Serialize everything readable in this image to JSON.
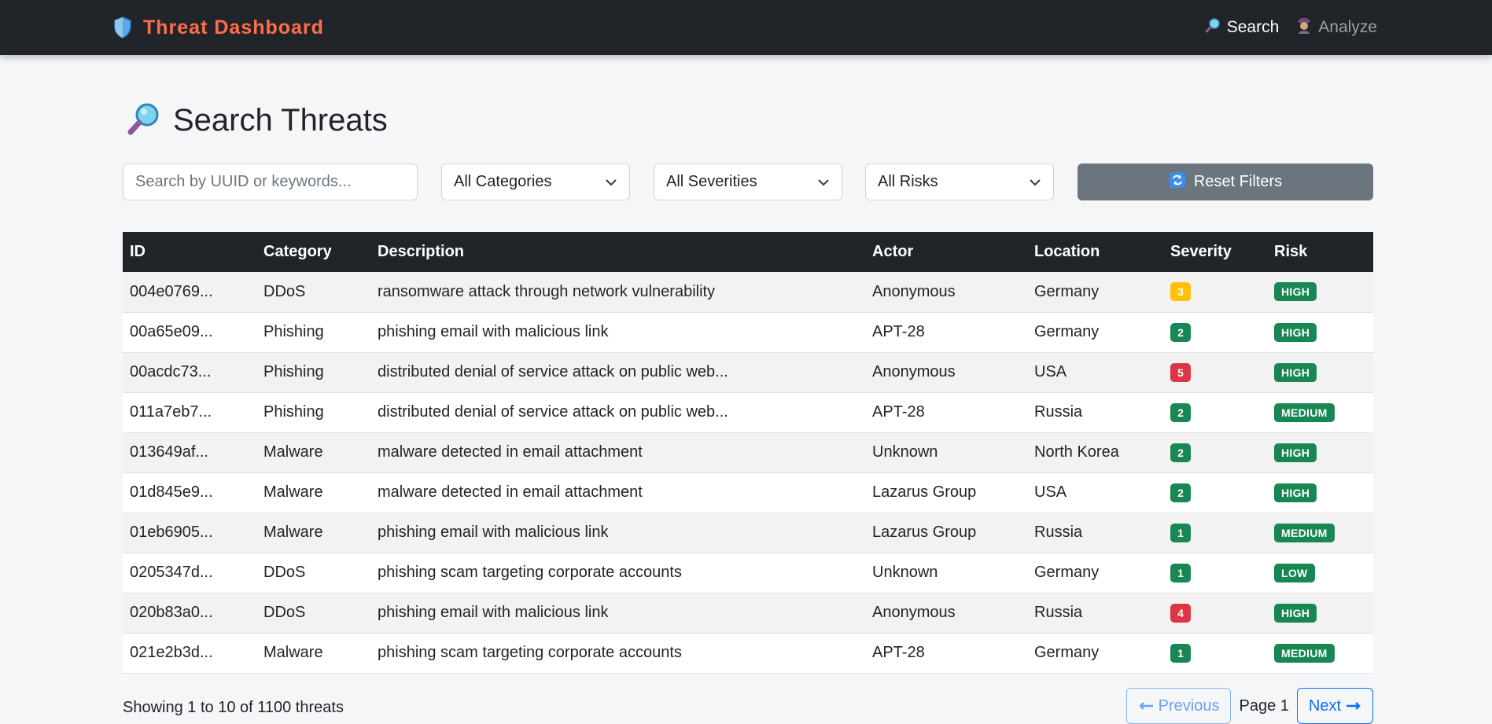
{
  "nav": {
    "brand_title": "Threat Dashboard",
    "brand_icon": "shield-icon",
    "links": [
      {
        "label": "Search",
        "icon": "magnifier-icon",
        "active": true
      },
      {
        "label": "Analyze",
        "icon": "detective-icon",
        "active": false
      }
    ]
  },
  "page": {
    "title": "Search Threats",
    "title_icon": "magnifier-icon"
  },
  "filters": {
    "search_placeholder": "Search by UUID or keywords...",
    "category_value": "All Categories",
    "severity_value": "All Severities",
    "risk_value": "All Risks",
    "reset_label": "Reset Filters"
  },
  "table": {
    "headers": {
      "id": "ID",
      "category": "Category",
      "description": "Description",
      "actor": "Actor",
      "location": "Location",
      "severity": "Severity",
      "risk": "Risk"
    },
    "rows": [
      {
        "id": "004e0769...",
        "category": "DDoS",
        "description": "ransomware attack through network vulnerability",
        "actor": "Anonymous",
        "location": "Germany",
        "severity": "3",
        "risk": "HIGH"
      },
      {
        "id": "00a65e09...",
        "category": "Phishing",
        "description": "phishing email with malicious link",
        "actor": "APT-28",
        "location": "Germany",
        "severity": "2",
        "risk": "HIGH"
      },
      {
        "id": "00acdc73...",
        "category": "Phishing",
        "description": "distributed denial of service attack on public web...",
        "actor": "Anonymous",
        "location": "USA",
        "severity": "5",
        "risk": "HIGH"
      },
      {
        "id": "011a7eb7...",
        "category": "Phishing",
        "description": "distributed denial of service attack on public web...",
        "actor": "APT-28",
        "location": "Russia",
        "severity": "2",
        "risk": "MEDIUM"
      },
      {
        "id": "013649af...",
        "category": "Malware",
        "description": "malware detected in email attachment",
        "actor": "Unknown",
        "location": "North Korea",
        "severity": "2",
        "risk": "HIGH"
      },
      {
        "id": "01d845e9...",
        "category": "Malware",
        "description": "malware detected in email attachment",
        "actor": "Lazarus Group",
        "location": "USA",
        "severity": "2",
        "risk": "HIGH"
      },
      {
        "id": "01eb6905...",
        "category": "Malware",
        "description": "phishing email with malicious link",
        "actor": "Lazarus Group",
        "location": "Russia",
        "severity": "1",
        "risk": "MEDIUM"
      },
      {
        "id": "0205347d...",
        "category": "DDoS",
        "description": "phishing scam targeting corporate accounts",
        "actor": "Unknown",
        "location": "Germany",
        "severity": "1",
        "risk": "LOW"
      },
      {
        "id": "020b83a0...",
        "category": "DDoS",
        "description": "phishing email with malicious link",
        "actor": "Anonymous",
        "location": "Russia",
        "severity": "4",
        "risk": "HIGH"
      },
      {
        "id": "021e2b3d...",
        "category": "Malware",
        "description": "phishing scam targeting corporate accounts",
        "actor": "APT-28",
        "location": "Germany",
        "severity": "1",
        "risk": "MEDIUM"
      }
    ]
  },
  "pagination": {
    "showing_text": "Showing 1 to 10 of 1100 threats",
    "previous_label": "Previous",
    "page_label": "Page 1",
    "next_label": "Next"
  },
  "colors": {
    "navbar_bg": "#212529",
    "brand_accent": "#ff6e4a",
    "severity_yellow": "#ffc107",
    "severity_green": "#198754",
    "severity_red": "#dc3545",
    "risk_green": "#198754",
    "reset_button": "#6c757d",
    "primary": "#0d6efd"
  }
}
